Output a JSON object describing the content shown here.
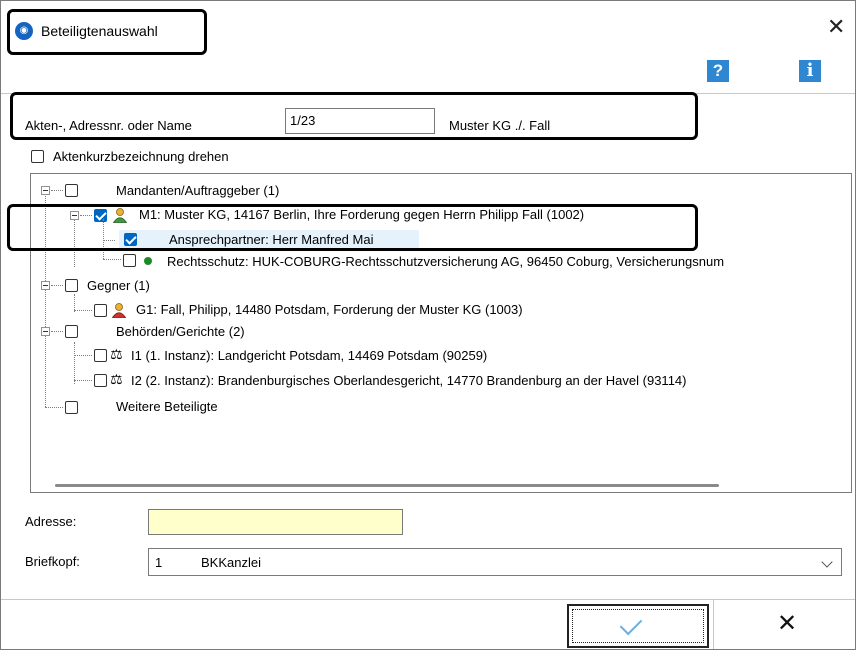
{
  "window": {
    "title": "Beteiligtenauswahl",
    "close_glyph": "✕"
  },
  "toolbar": {
    "help_label": "?",
    "info_label": "i"
  },
  "search": {
    "label": "Akten-, Adressnr. oder Name",
    "value": "1/23",
    "result": "Muster KG ./. Fall"
  },
  "flip_option": {
    "label": "Aktenkurzbezeichnung drehen",
    "checked": false
  },
  "tree": {
    "mandanten": "Mandanten/Auftraggeber (1)",
    "m1": "M1: Muster KG, 14167 Berlin, Ihre Forderung gegen Herrn Philipp Fall (1002)",
    "ansprechpartner": "Ansprechpartner: Herr Manfred Mai",
    "rechtsschutz": "Rechtsschutz: HUK-COBURG-Rechtsschutzversicherung AG, 96450 Coburg, Versicherungsnum",
    "gegner": "Gegner (1)",
    "g1": "G1: Fall, Philipp, 14480 Potsdam, Forderung der Muster KG (1003)",
    "behoerden": "Behörden/Gerichte (2)",
    "i1": "I1 (1. Instanz): Landgericht Potsdam, 14469 Potsdam (90259)",
    "i2": "I2 (2. Instanz): Brandenburgisches Oberlandesgericht, 14770 Brandenburg an der Havel (93114)",
    "weitere": "Weitere Beteiligte"
  },
  "address": {
    "label": "Adresse:",
    "value": ""
  },
  "letterhead": {
    "label": "Briefkopf:",
    "number": "1",
    "name": "BKKanzlei"
  },
  "buttons": {
    "cancel_glyph": "✕"
  },
  "colors": {
    "accent": "#0067c0",
    "help_blue": "#2f86d1",
    "address_bg": "#ffffcc"
  }
}
